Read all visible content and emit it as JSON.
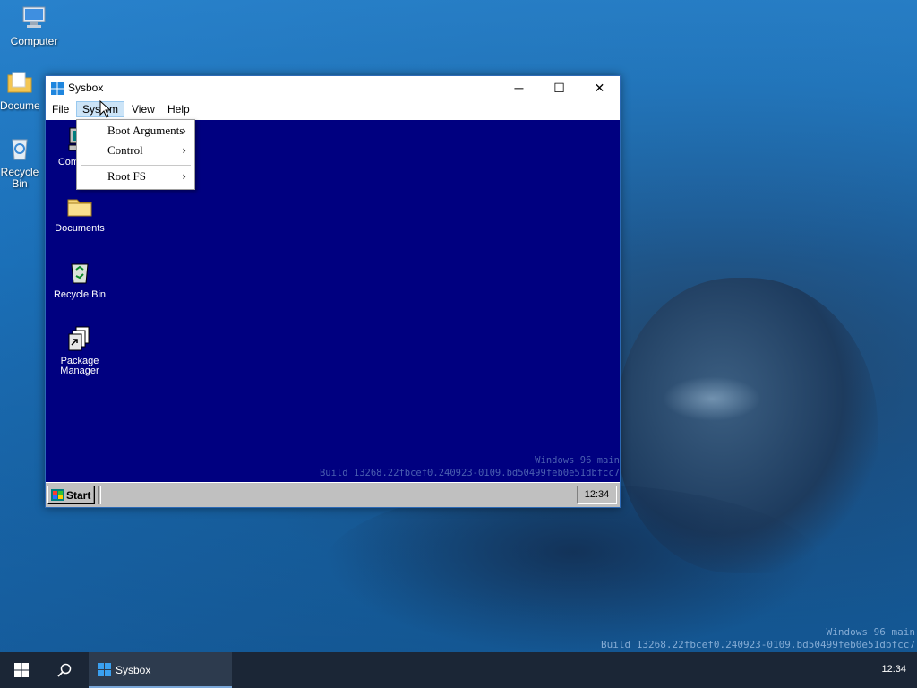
{
  "desktop": {
    "icons": [
      {
        "label": "Computer"
      },
      {
        "label": "Documents"
      },
      {
        "label": "Recycle Bin"
      }
    ],
    "watermark_line1": "Windows 96 main",
    "watermark_line2": "Build 13268.22fbcef0.240923-0109.bd50499feb0e51dbfcc7"
  },
  "window": {
    "title": "Sysbox",
    "menu": [
      "File",
      "System",
      "View",
      "Help"
    ],
    "active_menu": "System",
    "controls": {
      "minimize": "─",
      "maximize": "☐",
      "close": "✕"
    }
  },
  "dropdown": {
    "items": [
      {
        "label": "Boot Arguments",
        "has_submenu": true
      },
      {
        "label": "Control",
        "has_submenu": true
      },
      {
        "label": "Root FS",
        "has_submenu": true
      }
    ]
  },
  "guest": {
    "icons": [
      {
        "label": "Computer"
      },
      {
        "label": "Documents"
      },
      {
        "label": "Recycle Bin"
      },
      {
        "label": "Package Manager"
      }
    ],
    "watermark_line1": "Windows 96 main",
    "watermark_line2": "Build 13268.22fbcef0.240923-0109.bd50499feb0e51dbfcc7",
    "start_label": "Start",
    "clock": "12:34"
  },
  "taskbar": {
    "app_label": "Sysbox",
    "clock": "12:34"
  },
  "colors": {
    "guest_bg": "#000080",
    "menu_highlight": "#cce4f7",
    "host_taskbar": "#1b2636"
  }
}
